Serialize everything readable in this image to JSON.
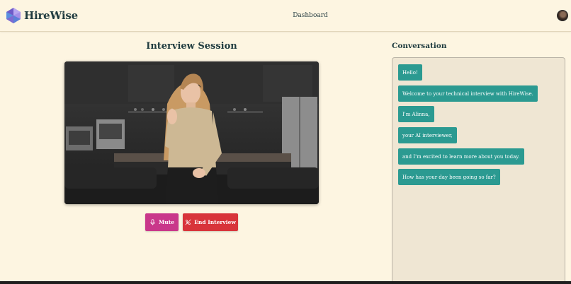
{
  "app": {
    "name": "HireWise"
  },
  "nav": {
    "dashboard": "Dashboard"
  },
  "session": {
    "title": "Interview Session"
  },
  "controls": {
    "mute_label": "Mute",
    "end_label": "End Interview"
  },
  "conversation": {
    "title": "Conversation",
    "messages": [
      "Hello!",
      "Welcome to your technical interview with HireWise.",
      "I'm Alinna,",
      "your AI interviewer,",
      "and I'm excited to learn more about you today.",
      "How has your day been going so far?"
    ]
  },
  "colors": {
    "background": "#fdf5e1",
    "mute_button": "#c9378a",
    "end_button": "#d8343a",
    "message_bubble": "#2b9a91",
    "panel": "#efe6d3"
  },
  "icons": {
    "logo": "hirewise-gem-logo",
    "mute": "microphone-icon",
    "end": "phone-off-icon",
    "avatar": "user-avatar"
  }
}
